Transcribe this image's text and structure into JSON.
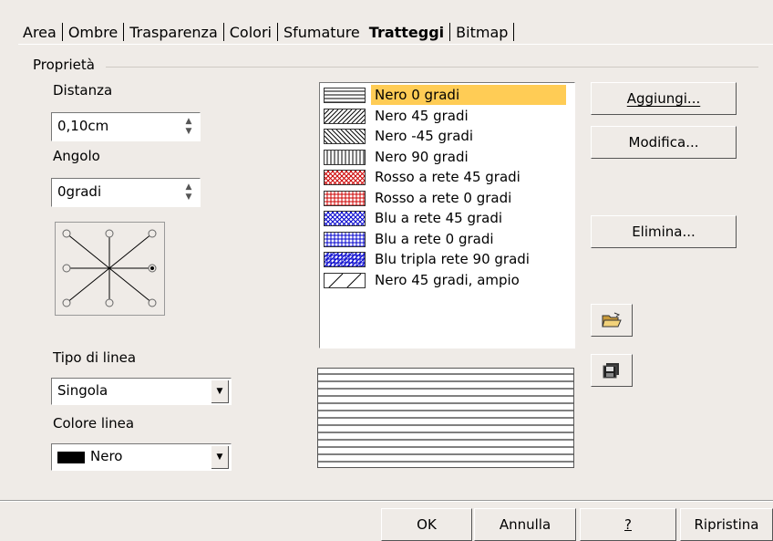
{
  "tabs": [
    {
      "label": "Area"
    },
    {
      "label": "Ombre"
    },
    {
      "label": "Trasparenza"
    },
    {
      "label": "Colori"
    },
    {
      "label": "Sfumature"
    },
    {
      "label": "Tratteggi",
      "active": true
    },
    {
      "label": "Bitmap"
    }
  ],
  "group_title": "Proprietà",
  "distance": {
    "label": "Distanza",
    "value": "0,10cm"
  },
  "angle": {
    "label": "Angolo",
    "value": "0gradi"
  },
  "line_type": {
    "label": "Tipo di linea",
    "value": "Singola"
  },
  "line_color": {
    "label": "Colore linea",
    "value": "Nero",
    "color": "#000000"
  },
  "hatch_list": [
    {
      "label": "Nero 0 gradi",
      "selected": true,
      "color": "#000000"
    },
    {
      "label": "Nero 45 gradi",
      "color": "#000000"
    },
    {
      "label": "Nero -45 gradi",
      "color": "#000000"
    },
    {
      "label": "Nero 90 gradi",
      "color": "#000000"
    },
    {
      "label": "Rosso a rete 45 gradi",
      "color": "#cc0000"
    },
    {
      "label": "Rosso a rete 0 gradi",
      "color": "#cc0000"
    },
    {
      "label": "Blu a rete 45 gradi",
      "color": "#0000cc"
    },
    {
      "label": "Blu a rete 0 gradi",
      "color": "#0000cc"
    },
    {
      "label": "Blu tripla rete 90 gradi",
      "color": "#0000cc"
    },
    {
      "label": "Nero 45 gradi, ampio",
      "color": "#000000"
    }
  ],
  "side_buttons": {
    "add": "Aggiungi...",
    "modify": "Modifica...",
    "delete": "Elimina..."
  },
  "bottom_buttons": {
    "ok": "OK",
    "cancel": "Annulla",
    "help": "?",
    "reset": "Ripristina"
  },
  "colors": {
    "selection": "#ffcc55",
    "dialog_bg": "#efebe7"
  }
}
